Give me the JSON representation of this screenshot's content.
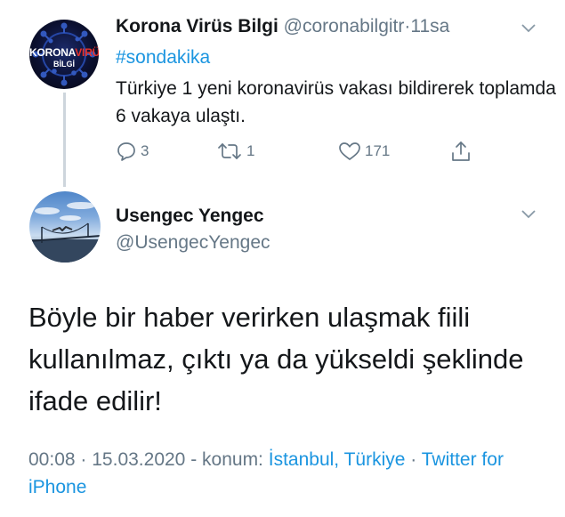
{
  "tweet1": {
    "avatar_logo_top_white": "KORONA",
    "avatar_logo_top_red": "VIRÜS",
    "avatar_logo_bottom": "BİLGİ",
    "display_name": "Korona Virüs Bilgi",
    "handle": "@coronabilgitr",
    "separator": "·",
    "time": "11sa",
    "hashtag": "#sondakika",
    "text": "Türkiye 1 yeni koronavirüs vakası bildirerek toplamda 6 vakaya ulaştı.",
    "actions": {
      "reply_count": "3",
      "retweet_count": "1",
      "like_count": "171"
    }
  },
  "tweet2": {
    "display_name": "Usengec Yengec",
    "handle": "@UsengecYengec",
    "text": "Böyle bir haber verirken ulaşmak fiili kullanılmaz, çıktı ya da yükseldi şeklinde ifade edilir!",
    "meta": {
      "time": "00:08",
      "sep1": "·",
      "date": "15.03.2020",
      "location_prefix": "- konum:",
      "location": "İstanbul, Türkiye",
      "sep2": "·",
      "source": "Twitter for iPhone"
    }
  },
  "colors": {
    "link_blue": "#1b95e0",
    "secondary_gray": "#657786",
    "text_dark": "#14171a",
    "thread_line": "#cdd5dc"
  },
  "icons": [
    "chevron-down-icon",
    "reply-icon",
    "retweet-icon",
    "like-icon",
    "share-icon"
  ]
}
